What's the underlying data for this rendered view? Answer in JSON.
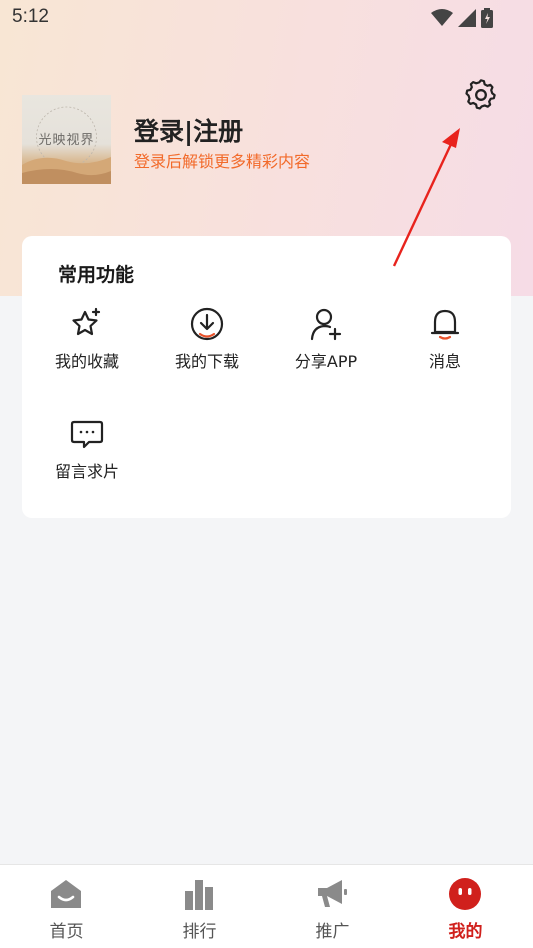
{
  "status_bar": {
    "time": "5:12",
    "icons": [
      "wifi-icon",
      "signal-icon",
      "battery-icon"
    ]
  },
  "header": {
    "settings_icon": "gear-icon",
    "avatar_text": "光映视界",
    "login_title": "登录|注册",
    "login_subtitle": "登录后解锁更多精彩内容"
  },
  "functions": {
    "title": "常用功能",
    "items": [
      {
        "label": "我的收藏",
        "icon": "star-icon"
      },
      {
        "label": "我的下载",
        "icon": "download-icon"
      },
      {
        "label": "分享APP",
        "icon": "add-user-icon"
      },
      {
        "label": "消息",
        "icon": "bell-icon"
      },
      {
        "label": "留言求片",
        "icon": "message-icon"
      }
    ]
  },
  "bottom_nav": {
    "items": [
      {
        "label": "首页",
        "icon": "home-icon",
        "active": false
      },
      {
        "label": "排行",
        "icon": "ranking-icon",
        "active": false
      },
      {
        "label": "推广",
        "icon": "megaphone-icon",
        "active": false
      },
      {
        "label": "我的",
        "icon": "profile-face-icon",
        "active": true
      }
    ]
  },
  "colors": {
    "accent": "#d0201c",
    "subtitle": "#f26a2a",
    "annotation_arrow": "#e8231d"
  }
}
